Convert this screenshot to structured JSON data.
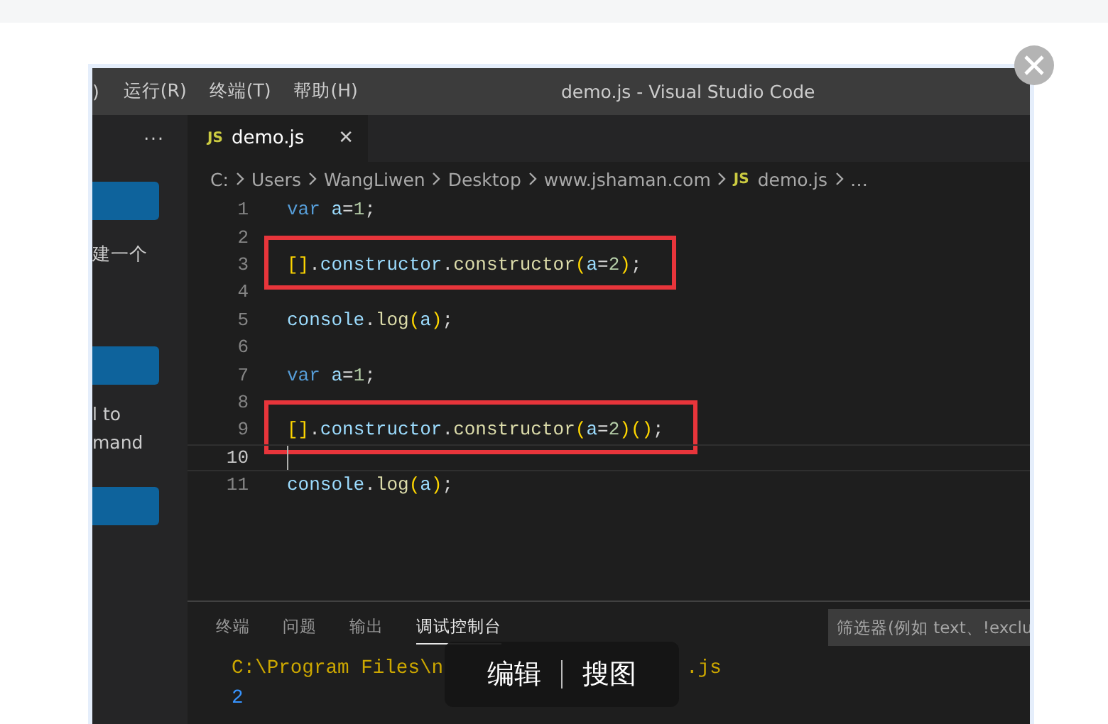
{
  "window": {
    "menu": [
      ")",
      "运行(R)",
      "终端(T)",
      "帮助(H)"
    ],
    "title": "demo.js - Visual Studio Code"
  },
  "sidebar": {
    "more": "···",
    "texts": [
      "建一个",
      "l to",
      "mand"
    ]
  },
  "tabs": [
    {
      "badge": "JS",
      "label": "demo.js",
      "close": "✕",
      "selected": true
    }
  ],
  "breadcrumb": [
    {
      "text": "C:",
      "kind": "folder"
    },
    {
      "text": "Users",
      "kind": "folder"
    },
    {
      "text": "WangLiwen",
      "kind": "folder"
    },
    {
      "text": "Desktop",
      "kind": "folder"
    },
    {
      "text": "www.jshaman.com",
      "kind": "folder"
    },
    {
      "text": "demo.js",
      "kind": "file",
      "badge": "JS"
    },
    {
      "text": "…",
      "kind": "folder"
    }
  ],
  "lines": [
    {
      "number": "1",
      "current": false,
      "boxed": false,
      "tokens": [
        {
          "text": "var",
          "kind": "keyword"
        },
        {
          "text": "a",
          "kind": "variable",
          "spaced": true
        },
        {
          "text": "=",
          "kind": "plain"
        },
        {
          "text": "1",
          "kind": "number"
        },
        {
          "text": ";",
          "kind": "plain"
        }
      ]
    },
    {
      "number": "2",
      "current": false,
      "boxed": false
    },
    {
      "number": "3",
      "current": false,
      "boxed": true,
      "tokens": [
        {
          "text": "[]",
          "kind": "bracket"
        },
        {
          "text": ".",
          "kind": "plain"
        },
        {
          "text": "constructor",
          "kind": "variable"
        },
        {
          "text": ".",
          "kind": "plain"
        },
        {
          "text": "constructor",
          "kind": "function"
        },
        {
          "text": "(",
          "kind": "bracket"
        },
        {
          "text": "a",
          "kind": "variable"
        },
        {
          "text": "=",
          "kind": "plain"
        },
        {
          "text": "2",
          "kind": "number"
        },
        {
          "text": ")",
          "kind": "bracket"
        },
        {
          "text": ";",
          "kind": "plain"
        }
      ]
    },
    {
      "number": "4",
      "current": false,
      "boxed": false
    },
    {
      "number": "5",
      "current": false,
      "boxed": false,
      "tokens": [
        {
          "text": "console",
          "kind": "variable"
        },
        {
          "text": ".",
          "kind": "plain"
        },
        {
          "text": "log",
          "kind": "function"
        },
        {
          "text": "(",
          "kind": "bracket"
        },
        {
          "text": "a",
          "kind": "variable"
        },
        {
          "text": ")",
          "kind": "bracket"
        },
        {
          "text": ";",
          "kind": "plain"
        }
      ]
    },
    {
      "number": "6",
      "current": false,
      "boxed": false
    },
    {
      "number": "7",
      "current": false,
      "boxed": false,
      "tokens": [
        {
          "text": "var",
          "kind": "keyword"
        },
        {
          "text": "a",
          "kind": "variable",
          "spaced": true
        },
        {
          "text": "=",
          "kind": "plain"
        },
        {
          "text": "1",
          "kind": "number"
        },
        {
          "text": ";",
          "kind": "plain"
        }
      ]
    },
    {
      "number": "8",
      "current": false,
      "boxed": false
    },
    {
      "number": "9",
      "current": false,
      "boxed": true,
      "tokens": [
        {
          "text": "[]",
          "kind": "bracket"
        },
        {
          "text": ".",
          "kind": "plain"
        },
        {
          "text": "constructor",
          "kind": "variable"
        },
        {
          "text": ".",
          "kind": "plain"
        },
        {
          "text": "constructor",
          "kind": "function"
        },
        {
          "text": "(",
          "kind": "bracket"
        },
        {
          "text": "a",
          "kind": "variable"
        },
        {
          "text": "=",
          "kind": "plain"
        },
        {
          "text": "2",
          "kind": "number"
        },
        {
          "text": ")()",
          "kind": "bracket"
        },
        {
          "text": ";",
          "kind": "plain"
        }
      ]
    },
    {
      "number": "10",
      "current": true,
      "boxed": false
    },
    {
      "number": "11",
      "current": false,
      "boxed": false,
      "tokens": [
        {
          "text": "console",
          "kind": "variable"
        },
        {
          "text": ".",
          "kind": "plain"
        },
        {
          "text": "log",
          "kind": "function"
        },
        {
          "text": "(",
          "kind": "bracket"
        },
        {
          "text": "a",
          "kind": "variable"
        },
        {
          "text": ")",
          "kind": "bracket"
        },
        {
          "text": ";",
          "kind": "plain"
        }
      ]
    }
  ],
  "panel": {
    "tabs": [
      {
        "label": "终端",
        "selected": false
      },
      {
        "label": "问题",
        "selected": false
      },
      {
        "label": "输出",
        "selected": false
      },
      {
        "label": "调试控制台",
        "selected": true
      }
    ],
    "filter": {
      "placeholder": "筛选器(例如 text、!exclu"
    },
    "output": [
      {
        "kind": "command",
        "segments": [
          "C:\\Program Files\\n",
          ".js"
        ]
      },
      {
        "kind": "value",
        "segments": [
          "2"
        ]
      }
    ]
  },
  "viewer_toolbar": {
    "actions": [
      "编辑",
      "搜图"
    ]
  }
}
